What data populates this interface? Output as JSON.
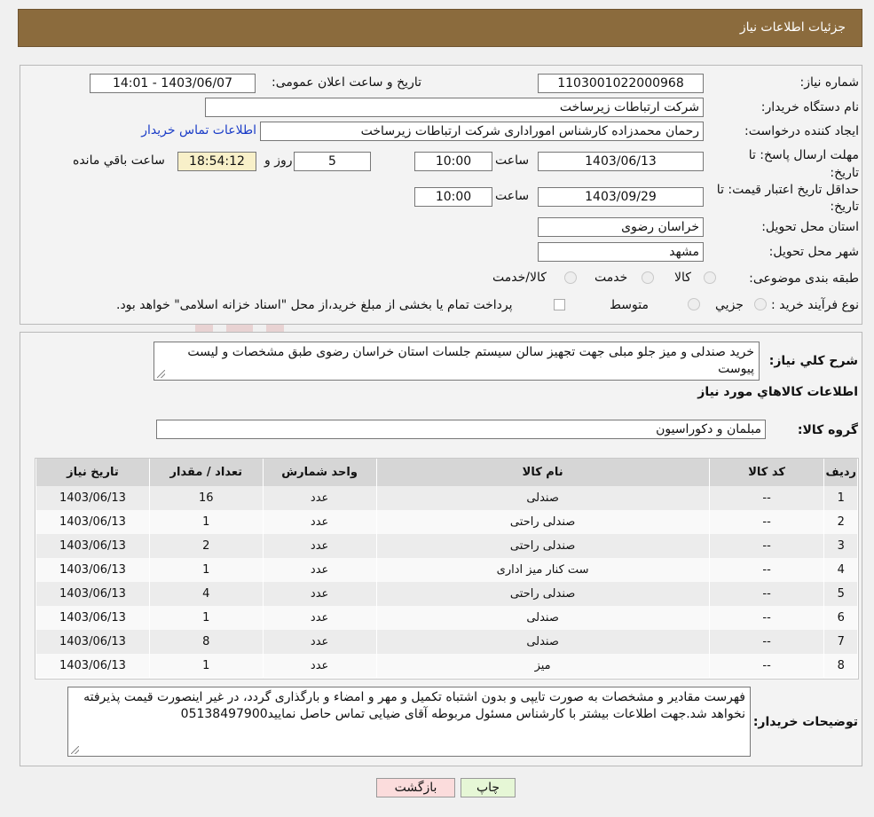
{
  "header": {
    "title": "جزئیات اطلاعات نیاز"
  },
  "form": {
    "need_number_label": "شماره نیاز:",
    "need_number": "1103001022000968",
    "announce_label": "تاریخ و ساعت اعلان عمومی:",
    "announce_value": "1403/06/07 - 14:01",
    "buyer_org_label": "نام دستگاه خریدار:",
    "buyer_org": "شرکت ارتباطات زیرساخت",
    "creator_label": "ایجاد کننده درخواست:",
    "creator": "رحمان محمدزاده کارشناس امورادارى  شرکت ارتباطات زیرساخت",
    "contact_link": "اطلاعات تماس خریدار",
    "deadline_label": "مهلت ارسال پاسخ: تا تاریخ:",
    "deadline_date": "1403/06/13",
    "time_label": "ساعت",
    "deadline_time": "10:00",
    "days_value": "5",
    "days_label": "روز و",
    "remaining_value": "18:54:12",
    "remaining_label": "ساعت باقي مانده",
    "validity_label": "حداقل تاریخ اعتبار قیمت: تا تاریخ:",
    "validity_date": "1403/09/29",
    "validity_time": "10:00",
    "province_label": "استان محل تحویل:",
    "province": "خراسان رضوی",
    "city_label": "شهر محل تحویل:",
    "city": "مشهد",
    "category_label": "طبقه بندی موضوعی:",
    "category_options": [
      "کالا",
      "خدمت",
      "کالا/خدمت"
    ],
    "process_label": "نوع فرآیند خرید :",
    "process_options": [
      "جزيي",
      "متوسط"
    ],
    "process_note": "پرداخت تمام یا بخشی از مبلغ خرید،از محل \"اسناد خزانه اسلامی\" خواهد بود."
  },
  "description": {
    "label": "شرح کلي نياز:",
    "text": "خرید صندلی و میز جلو مبلی جهت تجهیز سالن سیستم جلسات استان خراسان رضوی طبق مشخصات و لیست پیوست"
  },
  "goods": {
    "title": "اطلاعات کالاهاي مورد نياز",
    "group_label": "گروه کالا:",
    "group_value": "مبلمان و دکوراسیون",
    "columns": [
      "رديف",
      "کد کالا",
      "نام کالا",
      "واحد شمارش",
      "تعداد / مقدار",
      "تاریخ نیاز"
    ],
    "rows": [
      [
        "1",
        "--",
        "صندلی",
        "عدد",
        "16",
        "1403/06/13"
      ],
      [
        "2",
        "--",
        "صندلی راحتی",
        "عدد",
        "1",
        "1403/06/13"
      ],
      [
        "3",
        "--",
        "صندلی راحتی",
        "عدد",
        "2",
        "1403/06/13"
      ],
      [
        "4",
        "--",
        "ست کنار میز اداری",
        "عدد",
        "1",
        "1403/06/13"
      ],
      [
        "5",
        "--",
        "صندلی راحتی",
        "عدد",
        "4",
        "1403/06/13"
      ],
      [
        "6",
        "--",
        "صندلی",
        "عدد",
        "1",
        "1403/06/13"
      ],
      [
        "7",
        "--",
        "صندلی",
        "عدد",
        "8",
        "1403/06/13"
      ],
      [
        "8",
        "--",
        "میز",
        "عدد",
        "1",
        "1403/06/13"
      ]
    ]
  },
  "buyer_notes": {
    "label": "توضیحات خریدار:",
    "text": "فهرست مقادیر و مشخصات به صورت تایپی و بدون اشتباه تکمیل و مهر و امضاء و بارگذاری گردد، در غیر اینصورت قیمت پذیرفته نخواهد شد.جهت اطلاعات بیشتر با کارشناس مسئول مربوطه آقای ضیایی تماس حاصل نمایید05138497900"
  },
  "buttons": {
    "print": "چاپ",
    "back": "بازگشت"
  },
  "watermark": {
    "text": "AriaTender.neT"
  },
  "colors": {
    "header": "#8b6b3d",
    "link": "#1a3cc7",
    "back_button": "#fbdcdc",
    "print_button": "#e6f7d6"
  }
}
